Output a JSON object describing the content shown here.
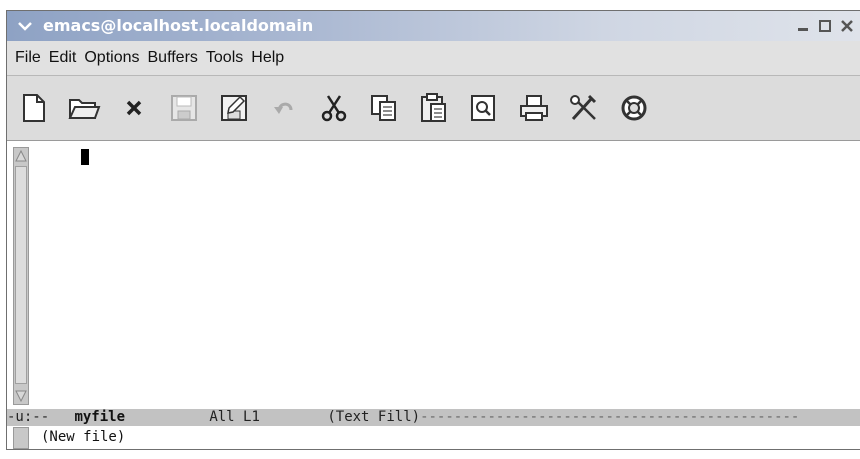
{
  "window": {
    "title": "emacs@localhost.localdomain"
  },
  "menubar": {
    "items": [
      "File",
      "Edit",
      "Options",
      "Buffers",
      "Tools",
      "Help"
    ]
  },
  "toolbar": {
    "tools": [
      "new-file-icon",
      "open-folder-icon",
      "close-icon",
      "save-icon",
      "save-as-icon",
      "undo-icon",
      "cut-icon",
      "copy-icon",
      "paste-icon",
      "search-icon",
      "print-icon",
      "preferences-icon",
      "help-lifebuoy-icon"
    ]
  },
  "modeline": {
    "prefix": "-u:--",
    "buffer_name": "myfile",
    "position": "All L1",
    "mode": "(Text Fill)",
    "dashes": "---------------------------------------------"
  },
  "minibuffer": {
    "message": "(New file)"
  }
}
